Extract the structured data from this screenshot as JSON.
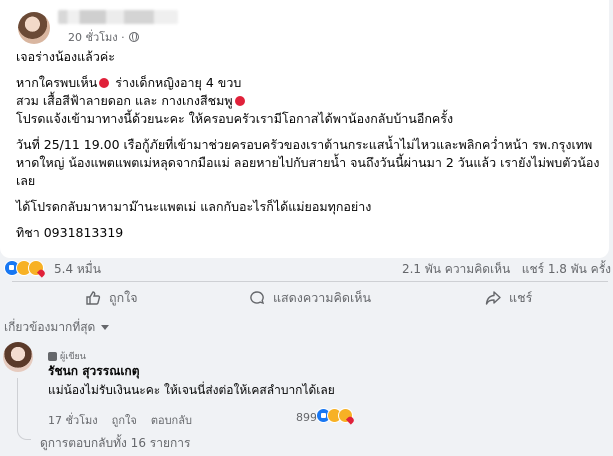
{
  "post": {
    "time": "20 ชั่วโมง ·",
    "lines": [
      "เจอร่างน้องแล้วค่ะ",
      "หากใครพบเห็น",
      "ร่างเด็กหญิงอายุ 4 ขวบ",
      "สวม เสื้อสีฟ้าลายดอก และ กางเกงสีชมพู",
      "โปรดแจ้งเข้ามาทางนี้ด้วยนะคะ ให้ครอบครัวเรามีโอกาสได้พาน้องกลับบ้านอีกครั้ง",
      "วันที่ 25/11 19.00  เรือกู้ภัยที่เข้ามาช่วยครอบครัวของเราต้านกระแสน้ำไม่ไหวและพลิกคว่ำหน้า รพ.กรุงเทพ",
      "หาดใหญ่ น้องแพตแพตเม่หลุดจากมือแม่ ลอยหายไปกับสายน้ำ จนถึงวันนี้ผ่านมา 2 วันแล้ว เรายังไม่พบตัวน้อง",
      "เลย",
      "ได้โปรดกลับมาหามาม๊านะแพตเม่ แลกกับอะไรก็ได้แม่ยอมทุกอย่าง",
      "ทิชา 0931813319"
    ]
  },
  "stats": {
    "reaction_count": "5.4 หมื่น",
    "comments": "2.1 พัน ความคิดเห็น",
    "shares": "แชร์ 1.8 พัน ครั้ง"
  },
  "actions": {
    "like": "ถูกใจ",
    "comment": "แสดงความคิดเห็น",
    "share": "แชร์"
  },
  "comments_filter": "เกี่ยวข้องมากที่สุด",
  "comment": {
    "badge": "ผู้เขียน",
    "author": "รัชนก สุวรรณเกตุ",
    "text": "แม่น้องไม่รับเงินนะคะ ให้เจนนี่ส่งต่อให้เคสลำบากได้เลย",
    "time": "17 ชั่วโมง",
    "like": "ถูกใจ",
    "reply": "ตอบกลับ",
    "reaction_count": "899"
  },
  "view_replies": "ดูการตอบกลับทั้ง 16 รายการ"
}
